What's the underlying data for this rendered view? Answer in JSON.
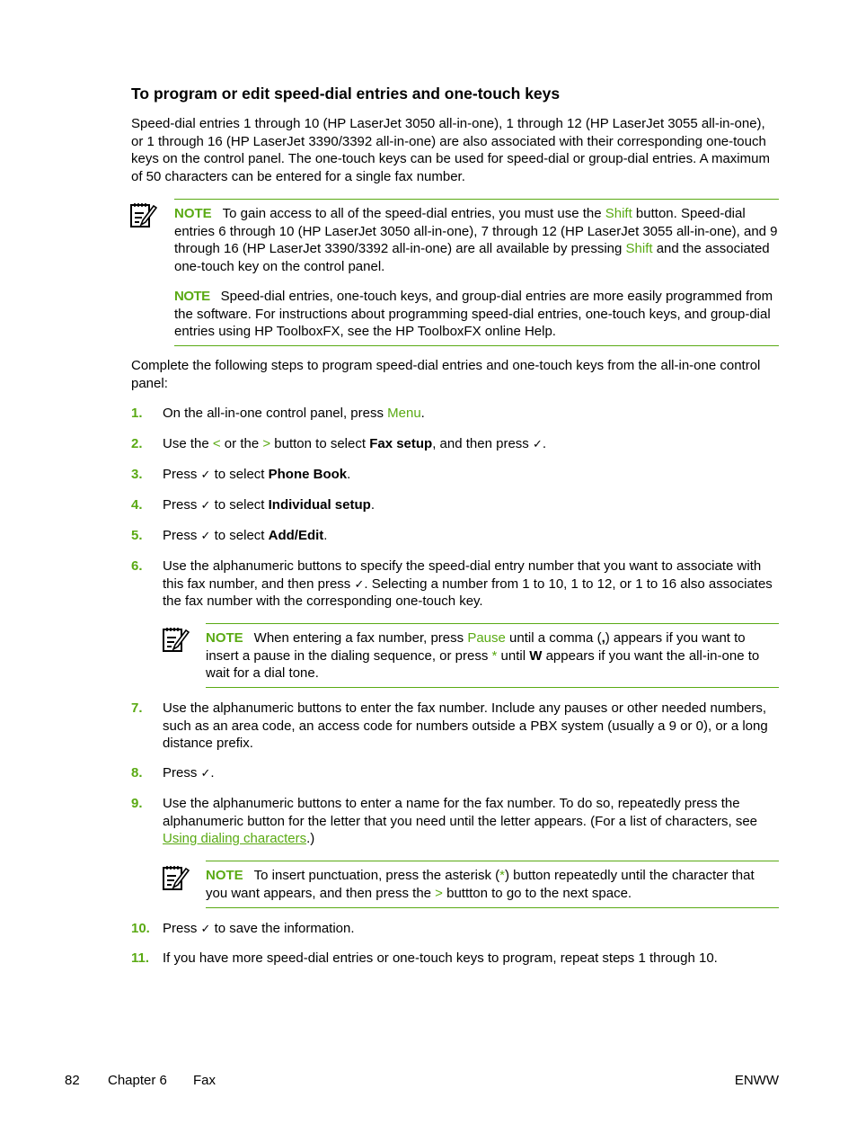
{
  "heading": "To program or edit speed-dial entries and one-touch keys",
  "intro": "Speed-dial entries 1 through 10 (HP LaserJet 3050 all-in-one), 1 through 12 (HP LaserJet 3055 all-in-one), or 1 through 16 (HP LaserJet 3390/3392 all-in-one) are also associated with their corresponding one-touch keys on the control panel. The one-touch keys can be used for speed-dial or group-dial entries. A maximum of 50 characters can be entered for a single fax number.",
  "note_label": "NOTE",
  "note1": {
    "a": "To gain access to all of the speed-dial entries, you must use the ",
    "shift1": "Shift",
    "b": " button. Speed-dial entries 6 through 10 (HP LaserJet 3050 all-in-one), 7 through 12 (HP LaserJet 3055 all-in-one), and 9 through 16 (HP LaserJet 3390/3392 all-in-one) are all available by pressing ",
    "shift2": "Shift",
    "c": " and the associated one-touch key on the control panel."
  },
  "note2": "Speed-dial entries, one-touch keys, and group-dial entries are more easily programmed from the software. For instructions about programming speed-dial entries, one-touch keys, and group-dial entries using HP ToolboxFX, see the HP ToolboxFX online Help.",
  "lead": "Complete the following steps to program speed-dial entries and one-touch keys from the all-in-one control panel:",
  "check_glyph": "✓",
  "steps": {
    "s1": {
      "num": "1.",
      "a": "On the all-in-one control panel, press ",
      "menu": "Menu",
      "b": "."
    },
    "s2": {
      "num": "2.",
      "a": "Use the ",
      "lt": "<",
      "b": " or the ",
      "gt": ">",
      "c": " button to select ",
      "bold": "Fax setup",
      "d": ", and then press ",
      "e": "."
    },
    "s3": {
      "num": "3.",
      "a": "Press ",
      "b": " to select ",
      "bold": "Phone Book",
      "c": "."
    },
    "s4": {
      "num": "4.",
      "a": "Press ",
      "b": " to select ",
      "bold": "Individual setup",
      "c": "."
    },
    "s5": {
      "num": "5.",
      "a": "Press ",
      "b": " to select ",
      "bold": "Add/Edit",
      "c": "."
    },
    "s6": {
      "num": "6.",
      "a": "Use the alphanumeric buttons to specify the speed-dial entry number that you want to associate with this fax number, and then press ",
      "b": ". Selecting a number from 1 to 10, 1 to 12, or 1 to 16 also associates the fax number with the corresponding one-touch key."
    },
    "s6_note": {
      "a": "When entering a fax number, press ",
      "pause": "Pause",
      "b": " until a comma (",
      "comma": ",",
      "c": ") appears if you want to insert a pause in the dialing sequence, or press ",
      "star": "*",
      "d": " until ",
      "w": "W",
      "e": " appears if you want the all-in-one to wait for a dial tone."
    },
    "s7": {
      "num": "7.",
      "text": "Use the alphanumeric buttons to enter the fax number. Include any pauses or other needed numbers, such as an area code, an access code for numbers outside a PBX system (usually a 9 or 0), or a long distance prefix."
    },
    "s8": {
      "num": "8.",
      "a": "Press ",
      "b": "."
    },
    "s9": {
      "num": "9.",
      "a": "Use the alphanumeric buttons to enter a name for the fax number. To do so, repeatedly press the alphanumeric button for the letter that you need until the letter appears. (For a list of characters, see ",
      "link": "Using dialing characters",
      "b": ".)"
    },
    "s9_note": {
      "a": "To insert punctuation, press the asterisk (",
      "star": "*",
      "b": ") button repeatedly until the character that you want appears, and then press the ",
      "gt": ">",
      "c": " buttton to go to the next space."
    },
    "s10": {
      "num": "10.",
      "a": "Press ",
      "b": " to save the information."
    },
    "s11": {
      "num": "11.",
      "text": "If you have more speed-dial entries or one-touch keys to program, repeat steps 1 through 10."
    }
  },
  "footer": {
    "page": "82",
    "chapter": "Chapter 6",
    "section": "Fax",
    "right": "ENWW"
  },
  "colors": {
    "accent": "#5aaa14"
  }
}
